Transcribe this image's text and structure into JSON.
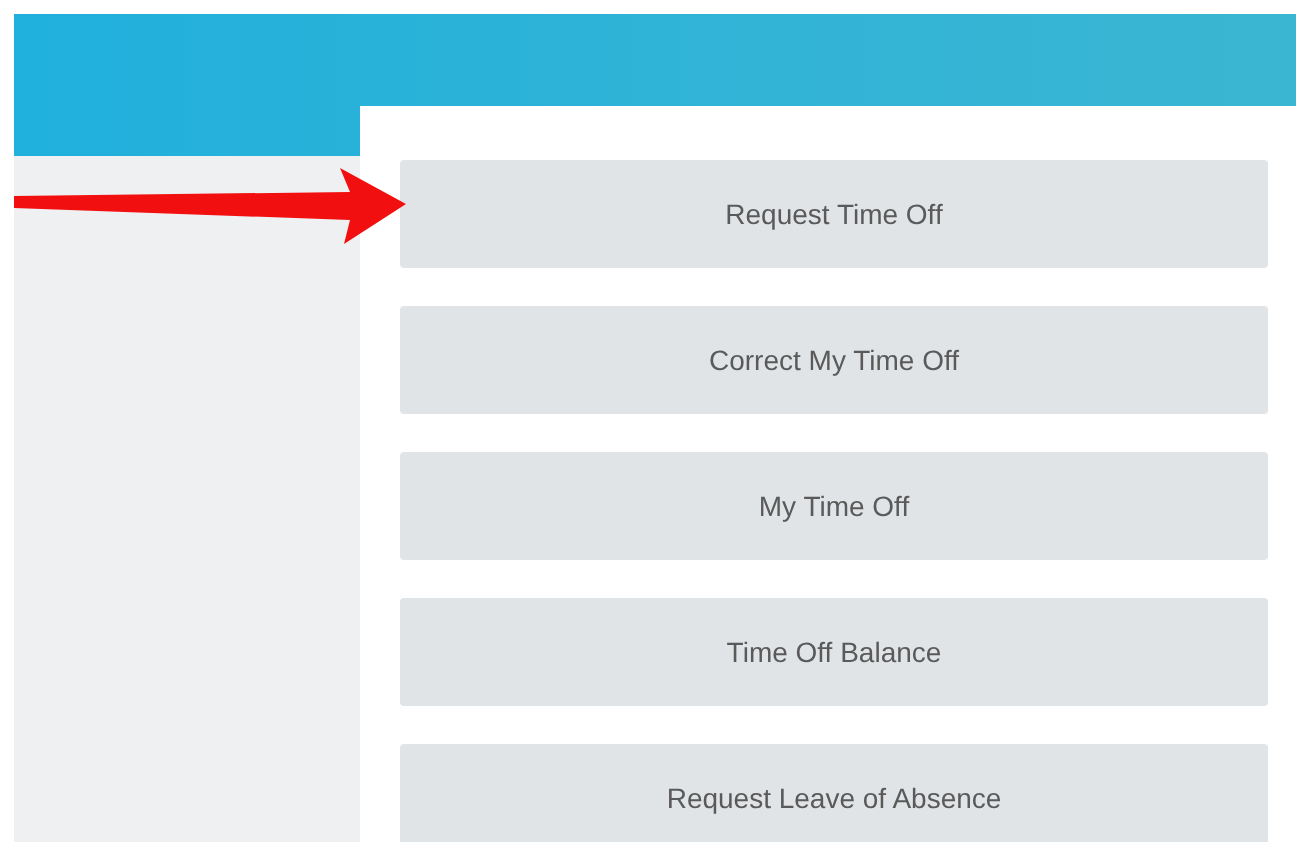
{
  "menu": [
    {
      "label": "Request Time Off"
    },
    {
      "label": "Correct My Time Off"
    },
    {
      "label": "My Time Off"
    },
    {
      "label": "Time Off Balance"
    },
    {
      "label": "Request Leave of Absence"
    }
  ]
}
